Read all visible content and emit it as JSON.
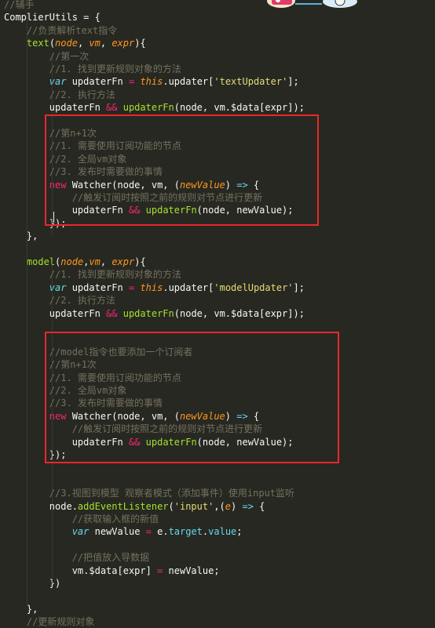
{
  "editor": {
    "theme_colors": {
      "background": "#272822",
      "comment": "#75715E",
      "keyword": "#F92672",
      "function": "#A6E22E",
      "string": "#E6DB74",
      "parameter": "#FD971F",
      "storage": "#66D9EF",
      "highlight_box": "#E8272B"
    },
    "lines": [
      [
        [
          "comment",
          "//辅手"
        ]
      ],
      [
        [
          "plain",
          "ComplierUtils = {"
        ]
      ],
      [
        [
          "plain",
          "    "
        ],
        [
          "comment",
          "//负责解析text指令"
        ]
      ],
      [
        [
          "plain",
          "    "
        ],
        [
          "func",
          "text"
        ],
        [
          "plain",
          "("
        ],
        [
          "param",
          "node"
        ],
        [
          "plain",
          ", "
        ],
        [
          "param",
          "vm"
        ],
        [
          "plain",
          ", "
        ],
        [
          "param",
          "expr"
        ],
        [
          "plain",
          "){"
        ]
      ],
      [
        [
          "plain",
          "        "
        ],
        [
          "comment",
          "//第一次"
        ]
      ],
      [
        [
          "plain",
          "        "
        ],
        [
          "comment",
          "//1. 找到更新规则对象的方法"
        ]
      ],
      [
        [
          "plain",
          "        "
        ],
        [
          "storage",
          "var"
        ],
        [
          "plain",
          " updaterFn "
        ],
        [
          "op",
          "="
        ],
        [
          "plain",
          " "
        ],
        [
          "this",
          "this"
        ],
        [
          "plain",
          ".updater["
        ],
        [
          "string",
          "'textUpdater'"
        ],
        [
          "plain",
          "];"
        ]
      ],
      [
        [
          "plain",
          "        "
        ],
        [
          "comment",
          "//2. 执行方法"
        ]
      ],
      [
        [
          "plain",
          "        updaterFn "
        ],
        [
          "op",
          "&&"
        ],
        [
          "plain",
          " "
        ],
        [
          "func",
          "updaterFn"
        ],
        [
          "plain",
          "(node, vm.$data[expr]);"
        ]
      ],
      [
        [
          "plain",
          ""
        ]
      ],
      [
        [
          "plain",
          "        "
        ],
        [
          "comment",
          "//第n+1次"
        ]
      ],
      [
        [
          "plain",
          "        "
        ],
        [
          "comment",
          "//1. 需要使用订阅功能的节点"
        ]
      ],
      [
        [
          "plain",
          "        "
        ],
        [
          "comment",
          "//2. 全局vm对象"
        ]
      ],
      [
        [
          "plain",
          "        "
        ],
        [
          "comment",
          "//3. 发布时需要做的事情"
        ]
      ],
      [
        [
          "plain",
          "        "
        ],
        [
          "keyword",
          "new"
        ],
        [
          "plain",
          " Watcher(node, vm, ("
        ],
        [
          "param",
          "newValue"
        ],
        [
          "plain",
          ") "
        ],
        [
          "storage",
          "=>"
        ],
        [
          "plain",
          " {"
        ]
      ],
      [
        [
          "plain",
          "            "
        ],
        [
          "comment",
          "//触发订阅时按照之前的规则对节点进行更新"
        ]
      ],
      [
        [
          "plain",
          "            updaterFn "
        ],
        [
          "op",
          "&&"
        ],
        [
          "plain",
          " "
        ],
        [
          "func",
          "updaterFn"
        ],
        [
          "plain",
          "(node, newValue);"
        ]
      ],
      [
        [
          "plain",
          "        });"
        ]
      ],
      [
        [
          "plain",
          "    },"
        ]
      ],
      [
        [
          "plain",
          ""
        ]
      ],
      [
        [
          "plain",
          "    "
        ],
        [
          "func",
          "model"
        ],
        [
          "plain",
          "("
        ],
        [
          "param",
          "node"
        ],
        [
          "plain",
          ","
        ],
        [
          "param",
          "vm"
        ],
        [
          "plain",
          ", "
        ],
        [
          "param",
          "expr"
        ],
        [
          "plain",
          "){"
        ]
      ],
      [
        [
          "plain",
          "        "
        ],
        [
          "comment",
          "//1. 找到更新规则对象的方法"
        ]
      ],
      [
        [
          "plain",
          "        "
        ],
        [
          "storage",
          "var"
        ],
        [
          "plain",
          " updaterFn "
        ],
        [
          "op",
          "="
        ],
        [
          "plain",
          " "
        ],
        [
          "this",
          "this"
        ],
        [
          "plain",
          ".updater["
        ],
        [
          "string",
          "'modelUpdater'"
        ],
        [
          "plain",
          "];"
        ]
      ],
      [
        [
          "plain",
          "        "
        ],
        [
          "comment",
          "//2. 执行方法"
        ]
      ],
      [
        [
          "plain",
          "        updaterFn "
        ],
        [
          "op",
          "&&"
        ],
        [
          "plain",
          " "
        ],
        [
          "func",
          "updaterFn"
        ],
        [
          "plain",
          "(node, vm.$data[expr]);"
        ]
      ],
      [
        [
          "plain",
          ""
        ]
      ],
      [
        [
          "plain",
          ""
        ]
      ],
      [
        [
          "plain",
          "        "
        ],
        [
          "comment",
          "//model指令也要添加一个订阅者"
        ]
      ],
      [
        [
          "plain",
          "        "
        ],
        [
          "comment",
          "//第n+1次"
        ]
      ],
      [
        [
          "plain",
          "        "
        ],
        [
          "comment",
          "//1. 需要使用订阅功能的节点"
        ]
      ],
      [
        [
          "plain",
          "        "
        ],
        [
          "comment",
          "//2. 全局vm对象"
        ]
      ],
      [
        [
          "plain",
          "        "
        ],
        [
          "comment",
          "//3. 发布时需要做的事情"
        ]
      ],
      [
        [
          "plain",
          "        "
        ],
        [
          "keyword",
          "new"
        ],
        [
          "plain",
          " Watcher(node, vm, ("
        ],
        [
          "param",
          "newValue"
        ],
        [
          "plain",
          ") "
        ],
        [
          "storage",
          "=>"
        ],
        [
          "plain",
          " {"
        ]
      ],
      [
        [
          "plain",
          "            "
        ],
        [
          "comment",
          "//触发订阅时按照之前的规则对节点进行更新"
        ]
      ],
      [
        [
          "plain",
          "            updaterFn "
        ],
        [
          "op",
          "&&"
        ],
        [
          "plain",
          " "
        ],
        [
          "func",
          "updaterFn"
        ],
        [
          "plain",
          "(node, newValue);"
        ]
      ],
      [
        [
          "plain",
          "        });"
        ]
      ],
      [
        [
          "plain",
          ""
        ]
      ],
      [
        [
          "plain",
          ""
        ]
      ],
      [
        [
          "plain",
          "        "
        ],
        [
          "comment",
          "//3.视图到模型 观察者模式（添加事件）使用input监听"
        ]
      ],
      [
        [
          "plain",
          "        node."
        ],
        [
          "func",
          "addEventListener"
        ],
        [
          "plain",
          "("
        ],
        [
          "string",
          "'input'"
        ],
        [
          "plain",
          ",("
        ],
        [
          "param",
          "e"
        ],
        [
          "plain",
          ") "
        ],
        [
          "storage",
          "=>"
        ],
        [
          "plain",
          " {"
        ]
      ],
      [
        [
          "plain",
          "            "
        ],
        [
          "comment",
          "//获取输入框的新值"
        ]
      ],
      [
        [
          "plain",
          "            "
        ],
        [
          "storage",
          "var"
        ],
        [
          "plain",
          " newValue "
        ],
        [
          "op",
          "="
        ],
        [
          "plain",
          " e."
        ],
        [
          "var",
          "target"
        ],
        [
          "plain",
          "."
        ],
        [
          "var",
          "value"
        ],
        [
          "plain",
          ";"
        ]
      ],
      [
        [
          "plain",
          ""
        ]
      ],
      [
        [
          "plain",
          "            "
        ],
        [
          "comment",
          "//把值放入导数据"
        ]
      ],
      [
        [
          "plain",
          "            vm.$data[expr] "
        ],
        [
          "op",
          "="
        ],
        [
          "plain",
          " newValue;"
        ]
      ],
      [
        [
          "plain",
          "        })"
        ]
      ],
      [
        [
          "plain",
          ""
        ]
      ],
      [
        [
          "plain",
          "    },"
        ]
      ],
      [
        [
          "plain",
          "    "
        ],
        [
          "comment",
          "//更新规则对象"
        ]
      ]
    ]
  }
}
